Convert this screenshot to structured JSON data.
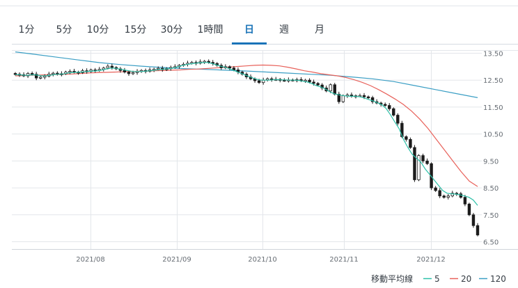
{
  "tabs": [
    {
      "label": "1分",
      "active": false
    },
    {
      "label": "5分",
      "active": false
    },
    {
      "label": "10分",
      "active": false
    },
    {
      "label": "15分",
      "active": false
    },
    {
      "label": "30分",
      "active": false
    },
    {
      "label": "1時間",
      "active": false
    },
    {
      "label": "日",
      "active": true
    },
    {
      "label": "週",
      "active": false
    },
    {
      "label": "月",
      "active": false
    }
  ],
  "colors": {
    "accent": "#1a73b8",
    "candle": "#1c1c1c",
    "ma5": "#2cc0a8",
    "ma20": "#e8615a",
    "ma120": "#3a9ec4",
    "grid": "#e3e6ea"
  },
  "chart_data": {
    "type": "line",
    "subtype": "candlestick with moving averages",
    "ylim": [
      6.5,
      13.5
    ],
    "y_ticks": [
      "13.50",
      "12.50",
      "11.50",
      "10.50",
      "9.50",
      "8.50",
      "7.50",
      "6.50"
    ],
    "x_ticks": [
      "2021/08",
      "2021/09",
      "2021/10",
      "2021/11",
      "2021/12"
    ],
    "grid": true,
    "legend": {
      "title": "移動平均線",
      "position": "bottom-right",
      "items": [
        "5",
        "20",
        "120"
      ]
    },
    "closes": [
      12.72,
      12.7,
      12.66,
      12.75,
      12.72,
      12.58,
      12.61,
      12.65,
      12.72,
      12.76,
      12.72,
      12.74,
      12.8,
      12.83,
      12.8,
      12.78,
      12.85,
      12.82,
      12.88,
      12.86,
      12.9,
      12.95,
      13.02,
      12.97,
      12.92,
      12.86,
      12.8,
      12.74,
      12.78,
      12.82,
      12.86,
      12.83,
      12.88,
      12.91,
      12.94,
      12.89,
      12.93,
      12.97,
      13.0,
      13.05,
      13.09,
      13.13,
      13.16,
      13.13,
      13.18,
      13.2,
      13.16,
      13.12,
      13.05,
      12.96,
      13.0,
      12.95,
      12.88,
      12.8,
      12.72,
      12.62,
      12.55,
      12.48,
      12.41,
      12.5,
      12.55,
      12.52,
      12.53,
      12.5,
      12.49,
      12.51,
      12.5,
      12.52,
      12.48,
      12.5,
      12.43,
      12.38,
      12.32,
      12.21,
      12.1,
      12.33,
      11.98,
      11.7,
      11.92,
      11.95,
      11.9,
      11.92,
      11.93,
      11.88,
      11.85,
      11.7,
      11.65,
      11.6,
      11.56,
      11.44,
      11.2,
      10.9,
      10.4,
      10.3,
      10.0,
      8.8,
      9.7,
      9.5,
      9.4,
      8.5,
      8.4,
      8.2,
      8.15,
      8.2,
      8.3,
      8.28,
      8.15,
      7.9,
      7.5,
      7.1,
      6.75
    ],
    "series": [
      {
        "name": "5",
        "values": [
          12.7,
          12.7,
          12.68,
          12.68,
          12.7,
          12.69,
          12.66,
          12.66,
          12.68,
          12.71,
          12.72,
          12.73,
          12.76,
          12.78,
          12.79,
          12.8,
          12.81,
          12.83,
          12.84,
          12.85,
          12.88,
          12.92,
          12.95,
          12.94,
          12.91,
          12.88,
          12.85,
          12.82,
          12.82,
          12.82,
          12.84,
          12.85,
          12.87,
          12.89,
          12.91,
          12.92,
          12.94,
          12.98,
          13.03,
          13.07,
          13.1,
          13.12,
          13.14,
          13.15,
          13.16,
          13.12,
          13.07,
          13.02,
          12.98,
          12.93,
          12.87,
          12.8,
          12.74,
          12.67,
          12.61,
          12.55,
          12.51,
          12.5,
          12.5,
          12.51,
          12.52,
          12.51,
          12.51,
          12.5,
          12.5,
          12.49,
          12.46,
          12.43,
          12.37,
          12.3,
          12.25,
          12.18,
          12.08,
          12.0,
          11.96,
          11.93,
          11.91,
          11.9,
          11.9,
          11.88,
          11.84,
          11.78,
          11.73,
          11.66,
          11.59,
          11.45,
          11.22,
          10.95,
          10.7,
          10.3,
          10.0,
          9.75,
          9.6,
          9.45,
          9.2,
          9.0,
          8.8,
          8.6,
          8.4,
          8.3,
          8.28,
          8.27,
          8.24,
          8.2,
          8.15,
          8.05,
          7.85
        ]
      },
      {
        "name": "20",
        "values": [
          12.66,
          12.67,
          12.68,
          12.69,
          12.7,
          12.71,
          12.72,
          12.73,
          12.75,
          12.77,
          12.78,
          12.79,
          12.8,
          12.81,
          12.82,
          12.83,
          12.84,
          12.85,
          12.86,
          12.87,
          12.88,
          12.9,
          12.91,
          12.93,
          12.95,
          12.97,
          12.99,
          13.01,
          13.03,
          13.05,
          13.06,
          13.05,
          13.03,
          12.98,
          12.92,
          12.85,
          12.8,
          12.74,
          12.7,
          12.66,
          12.6,
          12.52,
          12.42,
          12.3,
          12.15,
          11.98,
          11.8,
          11.6,
          11.35,
          11.05,
          10.7,
          10.3,
          9.9,
          9.5,
          9.1,
          8.75,
          8.55
        ]
      },
      {
        "name": "120",
        "values": [
          13.55,
          13.45,
          13.35,
          13.25,
          13.15,
          13.08,
          13.02,
          12.97,
          12.93,
          12.9,
          12.87,
          12.84,
          12.8,
          12.76,
          12.72,
          12.68,
          12.62,
          12.55,
          12.45,
          12.3,
          12.15,
          12.0,
          11.85
        ]
      }
    ]
  }
}
